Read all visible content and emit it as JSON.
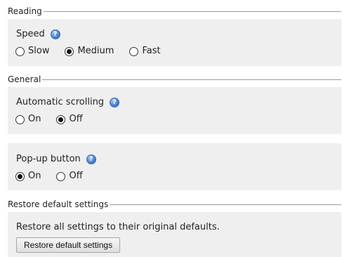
{
  "reading": {
    "legend": "Reading",
    "speed": {
      "label": "Speed",
      "options": [
        {
          "label": "Slow",
          "checked": false
        },
        {
          "label": "Medium",
          "checked": true
        },
        {
          "label": "Fast",
          "checked": false
        }
      ]
    }
  },
  "general": {
    "legend": "General",
    "auto_scroll": {
      "label": "Automatic scrolling",
      "options": [
        {
          "label": "On",
          "checked": false
        },
        {
          "label": "Off",
          "checked": true
        }
      ]
    },
    "popup": {
      "label": "Pop-up button",
      "options": [
        {
          "label": "On",
          "checked": true
        },
        {
          "label": "Off",
          "checked": false
        }
      ]
    }
  },
  "restore": {
    "legend": "Restore default settings",
    "description": "Restore all settings to their original defaults.",
    "button_label": "Restore default settings"
  },
  "icons": {
    "help": "help-icon",
    "help_color": "#4f86d0"
  }
}
